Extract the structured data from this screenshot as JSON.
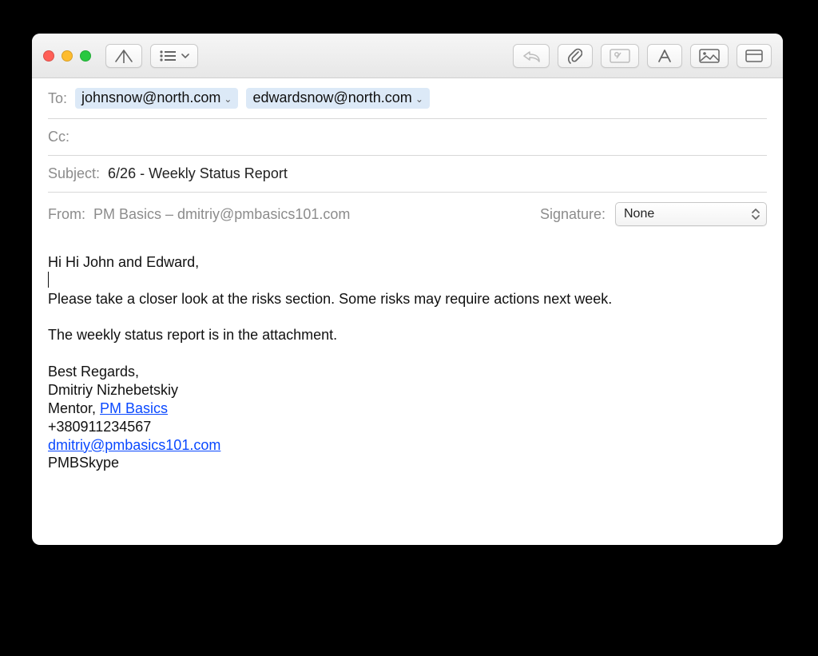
{
  "toolbar": {
    "icons": {
      "send": "send-icon",
      "list": "list-icon",
      "reply": "reply-icon",
      "attach": "paperclip-icon",
      "inline_image": "inline-image-icon",
      "format": "format-text-icon",
      "media": "media-browser-icon",
      "show_hide": "toggle-fields-icon"
    }
  },
  "fields": {
    "to_label": "To:",
    "to_recipients": [
      "johnsnow@north.com",
      "edwardsnow@north.com"
    ],
    "cc_label": "Cc:",
    "cc_recipients": [],
    "subject_label": "Subject:",
    "subject_value": "6/26 - Weekly Status Report",
    "from_label": "From:",
    "from_value": "PM Basics – dmitriy@pmbasics101.com",
    "signature_label": "Signature:",
    "signature_value": "None"
  },
  "body": {
    "line1": "Hi Hi John and Edward,",
    "line3": "Please take a closer look at the risks section. Some risks may require actions next week.",
    "line5": "The weekly status report is in the attachment.",
    "sig_regards": "Best Regards,",
    "sig_name": "Dmitriy Nizhebetskiy",
    "sig_role_prefix": "Mentor, ",
    "sig_role_link": "PM Basics",
    "sig_phone": "+380911234567",
    "sig_email": "dmitriy@pmbasics101.com",
    "sig_skype": "PMBSkype"
  },
  "colors": {
    "link": "#0a49ff",
    "chip_bg": "#dce9f7",
    "field_label": "#8c8c8c",
    "traffic_red": "#ff5f57",
    "traffic_yellow": "#febc2e",
    "traffic_green": "#28c840"
  }
}
